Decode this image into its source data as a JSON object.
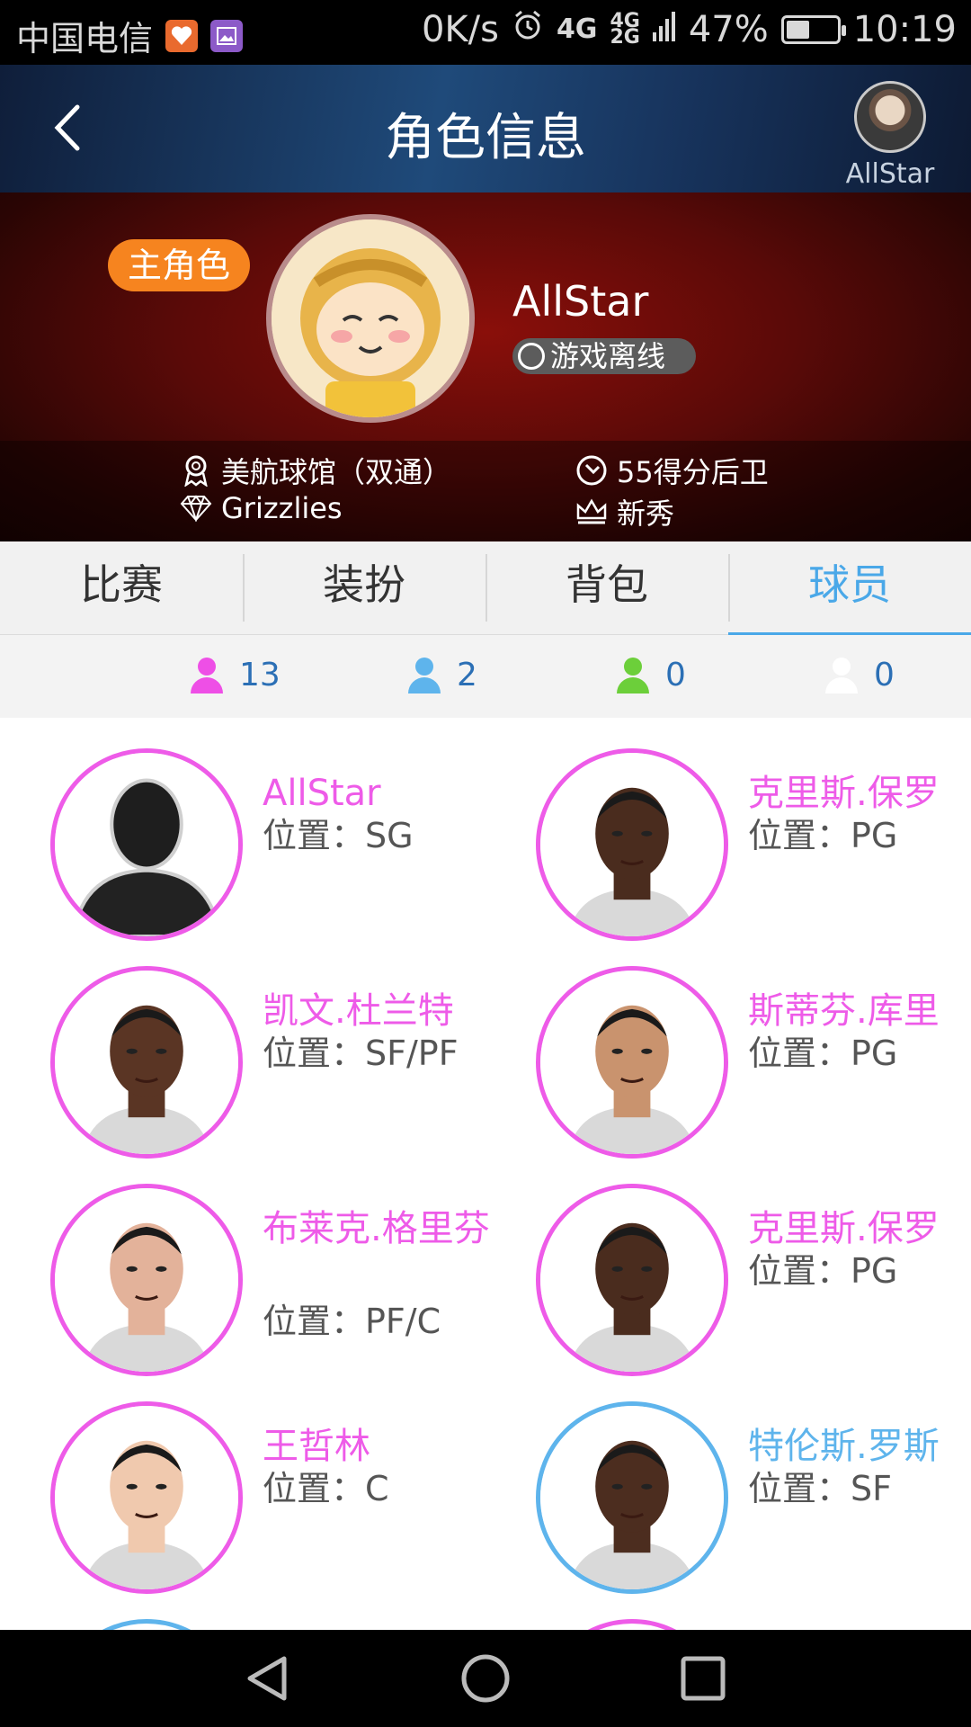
{
  "status_bar": {
    "carrier": "中国电信",
    "speed": "0K/s",
    "network_main": "4G",
    "network_sub_top": "4G",
    "network_sub_bottom": "2G",
    "battery": "47%",
    "battery_level": 0.47,
    "time": "10:19"
  },
  "header": {
    "title": "角色信息",
    "user_name": "AllStar"
  },
  "profile": {
    "role_badge": "主角色",
    "name": "AllStar",
    "game_status": "游戏离线",
    "venue": "美航球馆（双通）",
    "team": "Grizzlies",
    "player_type": "55得分后卫",
    "rank": "新秀"
  },
  "tabs": [
    {
      "label": "比赛",
      "active": false
    },
    {
      "label": "装扮",
      "active": false
    },
    {
      "label": "背包",
      "active": false
    },
    {
      "label": "球员",
      "active": true
    }
  ],
  "counts": [
    {
      "value": "13",
      "color": "#ee4fe6"
    },
    {
      "value": "2",
      "color": "#5eb4ec"
    },
    {
      "value": "0",
      "color": "#6ccf3a"
    },
    {
      "value": "0",
      "color": "#ffffff"
    }
  ],
  "players": [
    {
      "name": "AllStar",
      "position": "位置：SG",
      "tier": "pink",
      "skin": "silhouette"
    },
    {
      "name": "克里斯.保罗",
      "position": "位置：PG",
      "tier": "pink",
      "skin": "#4a2c1e"
    },
    {
      "name": "凯文.杜兰特",
      "position": "位置：SF/PF",
      "tier": "pink",
      "skin": "#5a3524"
    },
    {
      "name": "斯蒂芬.库里",
      "position": "位置：PG",
      "tier": "pink",
      "skin": "#c9936e"
    },
    {
      "name": "布莱克.格里芬",
      "position": "位置：PF/C",
      "tier": "pink",
      "skin": "#e3b29a"
    },
    {
      "name": "克里斯.保罗",
      "position": "位置：PG",
      "tier": "pink",
      "skin": "#4a2c1e"
    },
    {
      "name": "王哲林",
      "position": "位置：C",
      "tier": "pink",
      "skin": "#f0c9ae"
    },
    {
      "name": "特伦斯.罗斯",
      "position": "位置：SF",
      "tier": "blue",
      "skin": "#4c2d1f"
    }
  ]
}
